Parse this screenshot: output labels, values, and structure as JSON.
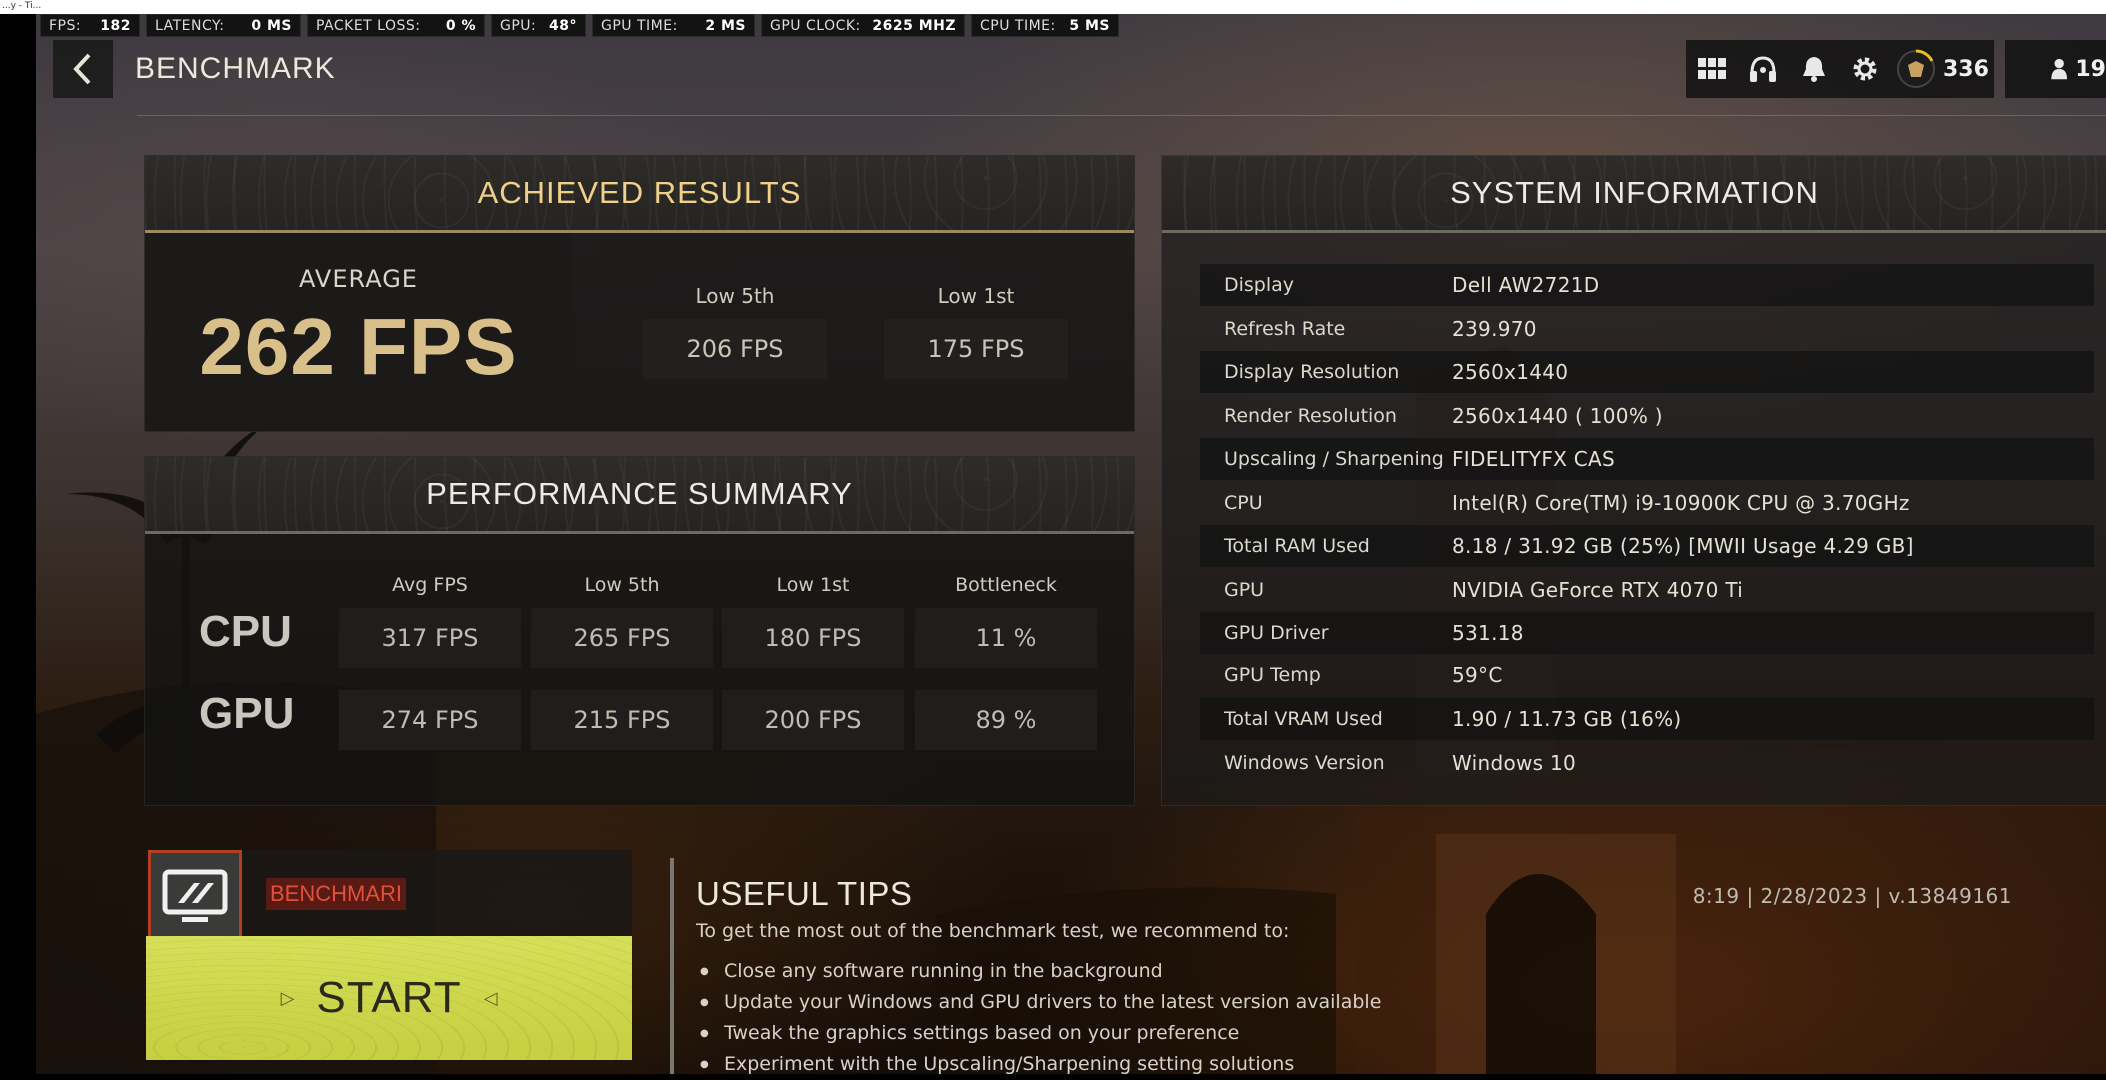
{
  "window": {
    "title": "...y - Ti..."
  },
  "hud": [
    {
      "label": "FPS:",
      "value": "182"
    },
    {
      "label": "LATENCY:",
      "value": "0 MS"
    },
    {
      "label": "PACKET LOSS:",
      "value": "0 %"
    },
    {
      "label": "GPU:",
      "value": "48°"
    },
    {
      "label": "GPU TIME:",
      "value": "2 MS"
    },
    {
      "label": "GPU CLOCK:",
      "value": "2625 MHZ"
    },
    {
      "label": "CPU TIME:",
      "value": "5 MS"
    }
  ],
  "header": {
    "title": "BENCHMARK",
    "back_icon": "chevron-left-icon",
    "level": "336",
    "friends_count": "19",
    "icons": [
      "grid-icon",
      "headset-icon",
      "bell-icon",
      "gear-icon",
      "rank-emblem-icon",
      "friends-icon"
    ]
  },
  "achieved": {
    "title": "ACHIEVED RESULTS",
    "average_label": "AVERAGE",
    "average_value": "262 FPS",
    "low5_label": "Low 5th",
    "low5_value": "206 FPS",
    "low1_label": "Low 1st",
    "low1_value": "175 FPS"
  },
  "performance": {
    "title": "PERFORMANCE SUMMARY",
    "columns": [
      "Avg FPS",
      "Low 5th",
      "Low 1st",
      "Bottleneck"
    ],
    "rows": [
      {
        "label": "CPU",
        "values": [
          "317 FPS",
          "265 FPS",
          "180 FPS",
          "11 %"
        ]
      },
      {
        "label": "GPU",
        "values": [
          "274 FPS",
          "215 FPS",
          "200 FPS",
          "89 %"
        ]
      }
    ]
  },
  "system": {
    "title": "SYSTEM INFORMATION",
    "rows": [
      {
        "label": "Display",
        "value": "Dell AW2721D"
      },
      {
        "label": "Refresh Rate",
        "value": "239.970"
      },
      {
        "label": "Display Resolution",
        "value": "2560x1440"
      },
      {
        "label": "Render Resolution",
        "value": "2560x1440 ( 100% )"
      },
      {
        "label": "Upscaling / Sharpening",
        "value": "FIDELITYFX CAS"
      },
      {
        "label": "CPU",
        "value": "Intel(R) Core(TM) i9-10900K CPU @ 3.70GHz"
      },
      {
        "label": "Total RAM Used",
        "value": "8.18 / 31.92 GB (25%) [MWII Usage 4.29 GB]"
      },
      {
        "label": "GPU",
        "value": "NVIDIA GeForce RTX 4070 Ti"
      },
      {
        "label": "GPU Driver",
        "value": "531.18"
      },
      {
        "label": "GPU Temp",
        "value": "59°C"
      },
      {
        "label": "Total VRAM Used",
        "value": "1.90 / 11.73 GB (16%)"
      },
      {
        "label": "Windows Version",
        "value": "Windows 10"
      }
    ]
  },
  "mode": {
    "tag": "BENCHMARI",
    "start_label": "START"
  },
  "tips": {
    "title": "USEFUL TIPS",
    "intro": "To get the most out of the benchmark test, we recommend to:",
    "items": [
      "Close any software running in the background",
      "Update your Windows and GPU drivers to the latest version available",
      "Tweak the graphics settings based on your preference",
      "Experiment with the Upscaling/Sharpening setting solutions"
    ]
  },
  "build_info": "8:19 | 2/28/2023 | v.13849161",
  "colors": {
    "accent_gold": "#f1d08a",
    "start_button": "#cfd84c",
    "tag_red": "#e0503a"
  }
}
